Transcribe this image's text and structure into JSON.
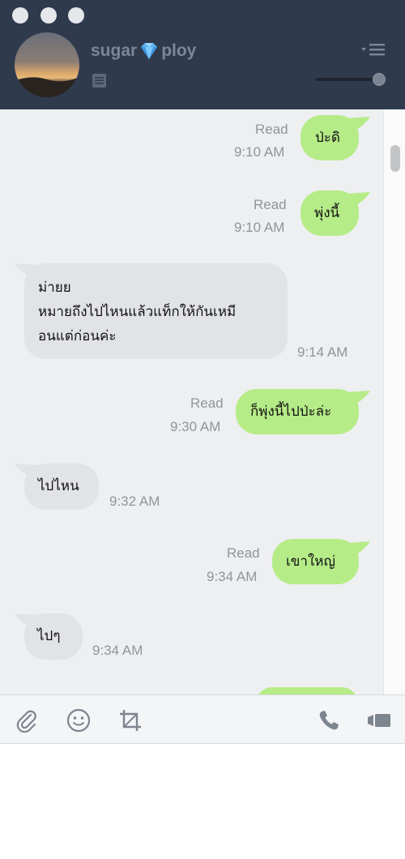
{
  "contact": {
    "name_left": "sugar",
    "name_right": "ploy"
  },
  "icons": {
    "window_controls": [
      "close-dot",
      "minimize-dot",
      "zoom-dot"
    ],
    "gem": "diamond-emoji",
    "note": "note-icon",
    "menu": "menu-icon",
    "toolbar": [
      "paperclip-icon",
      "emoji-icon",
      "crop-icon",
      "phone-icon",
      "video-icon"
    ]
  },
  "messages": [
    {
      "side": "right",
      "text": "ป่ะดิ",
      "read": "Read",
      "time": "9:10 AM"
    },
    {
      "side": "right",
      "text": "พุ่งนี้",
      "read": "Read",
      "time": "9:10 AM"
    },
    {
      "side": "left",
      "lines": [
        "ม่ายย",
        "หมายถึงไปไหนแล้วแท็กให้กันเหมี",
        "อนแต่ก่อนค่ะ"
      ],
      "time": "9:14 AM"
    },
    {
      "side": "right",
      "text": "ก็พุ่งนี้ไปป่ะล่ะ",
      "read": "Read",
      "time": "9:30 AM"
    },
    {
      "side": "left",
      "text": "ไปไหน",
      "time": "9:32 AM"
    },
    {
      "side": "right",
      "text": "เขาใหญ่",
      "read": "Read",
      "time": "9:34 AM"
    },
    {
      "side": "left",
      "text": "ไปๆ",
      "time": "9:34 AM"
    }
  ],
  "colors": {
    "header": "#2f3a4d",
    "outgoing_bubble": "#b6ec88",
    "incoming_bubble": "#e1e3e7",
    "chat_background": "#eeeff1"
  }
}
